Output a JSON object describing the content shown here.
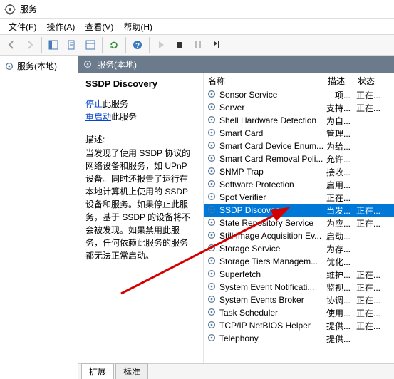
{
  "title": "服务",
  "menu": {
    "file": "文件(F)",
    "action": "操作(A)",
    "view": "查看(V)",
    "help": "帮助(H)"
  },
  "tree": {
    "root": "服务(本地)"
  },
  "right_header": "服务(本地)",
  "selected": {
    "name": "SSDP Discovery",
    "stop_link": "停止",
    "stop_suffix": "此服务",
    "restart_link": "重启动",
    "restart_suffix": "此服务",
    "desc_label": "描述:",
    "desc": "当发现了使用 SSDP 协议的网络设备和服务，如 UPnP 设备。同时还报告了运行在本地计算机上使用的 SSDP 设备和服务。如果停止此服务，基于 SSDP 的设备将不会被发现。如果禁用此服务，任何依赖此服务的服务都无法正常启动。"
  },
  "columns": {
    "name": "名称",
    "desc": "描述",
    "stat": "状态"
  },
  "rows": [
    {
      "name": "Sensor Service",
      "desc": "一项...",
      "stat": "正在..."
    },
    {
      "name": "Server",
      "desc": "支持...",
      "stat": "正在..."
    },
    {
      "name": "Shell Hardware Detection",
      "desc": "为自...",
      "stat": ""
    },
    {
      "name": "Smart Card",
      "desc": "管理...",
      "stat": ""
    },
    {
      "name": "Smart Card Device Enum...",
      "desc": "为给...",
      "stat": ""
    },
    {
      "name": "Smart Card Removal Poli...",
      "desc": "允许...",
      "stat": ""
    },
    {
      "name": "SNMP Trap",
      "desc": "接收...",
      "stat": ""
    },
    {
      "name": "Software Protection",
      "desc": "启用...",
      "stat": ""
    },
    {
      "name": "Spot Verifier",
      "desc": "正在...",
      "stat": ""
    },
    {
      "name": "SSDP Discovery",
      "desc": "当发...",
      "stat": "正在...",
      "selected": true
    },
    {
      "name": "State Repository Service",
      "desc": "为应...",
      "stat": "正在..."
    },
    {
      "name": "Still Image Acquisition Ev...",
      "desc": "启动...",
      "stat": ""
    },
    {
      "name": "Storage Service",
      "desc": "为存...",
      "stat": ""
    },
    {
      "name": "Storage Tiers Managem...",
      "desc": "优化...",
      "stat": ""
    },
    {
      "name": "Superfetch",
      "desc": "维护...",
      "stat": "正在..."
    },
    {
      "name": "System Event Notificati...",
      "desc": "监视...",
      "stat": "正在..."
    },
    {
      "name": "System Events Broker",
      "desc": "协调...",
      "stat": "正在..."
    },
    {
      "name": "Task Scheduler",
      "desc": "使用...",
      "stat": "正在..."
    },
    {
      "name": "TCP/IP NetBIOS Helper",
      "desc": "提供...",
      "stat": "正在..."
    },
    {
      "name": "Telephony",
      "desc": "提供...",
      "stat": ""
    }
  ],
  "tabs": {
    "extended": "扩展",
    "standard": "标准"
  }
}
